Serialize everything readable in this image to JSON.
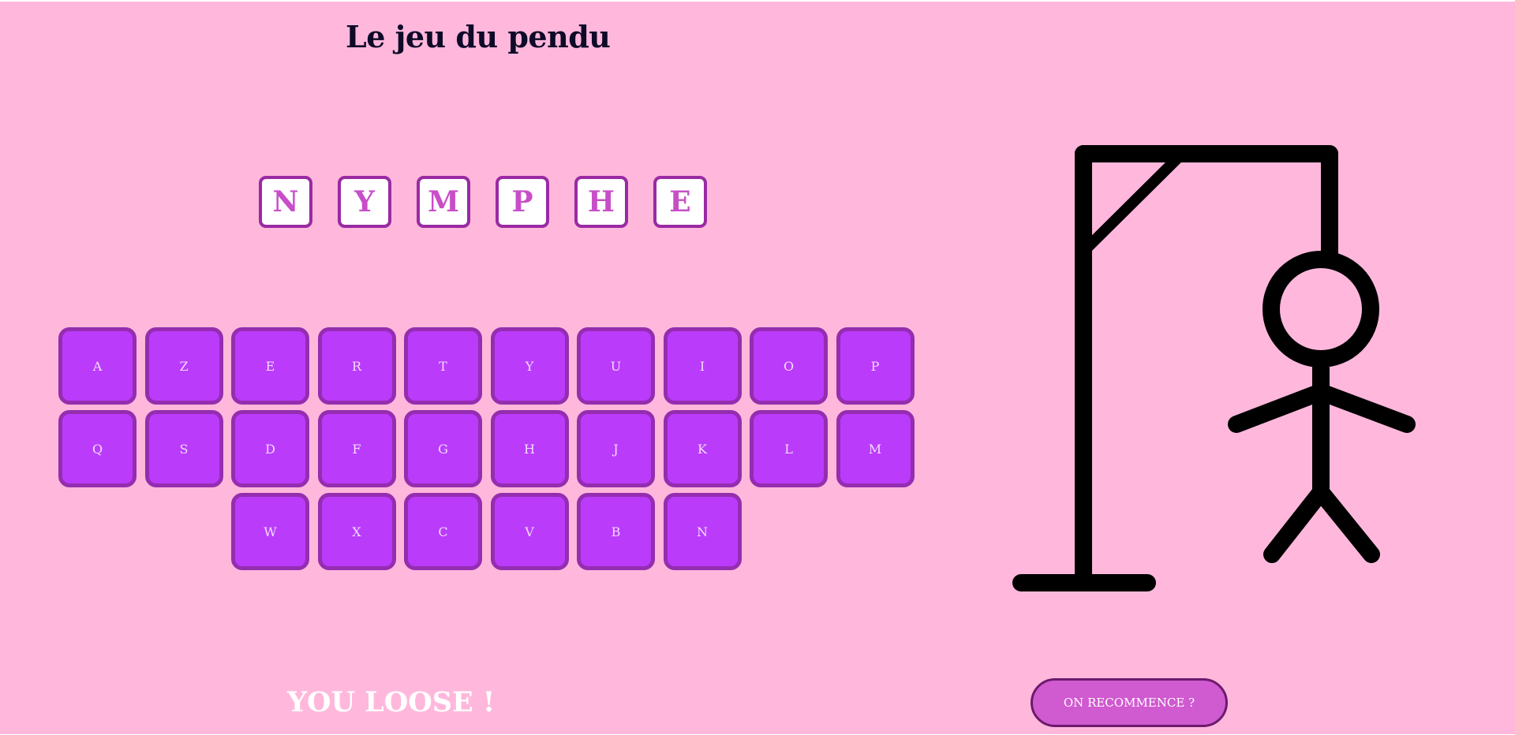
{
  "game": {
    "title": "Le jeu du pendu",
    "word_letters": [
      "N",
      "Y",
      "M",
      "P",
      "H",
      "E"
    ],
    "result_text": "YOU LOOSE !",
    "restart_label": "ON RECOMMENCE ?"
  },
  "keyboard": {
    "row1": [
      "A",
      "Z",
      "E",
      "R",
      "T",
      "Y",
      "U",
      "I",
      "O",
      "P"
    ],
    "row2": [
      "Q",
      "S",
      "D",
      "F",
      "G",
      "H",
      "J",
      "K",
      "L",
      "M"
    ],
    "row3": [
      "W",
      "X",
      "C",
      "V",
      "B",
      "N"
    ]
  },
  "colors": {
    "background": "#ffb8dc",
    "key_fill": "#bb3bfb",
    "key_border": "#952db0",
    "letter_color": "#c84ec8",
    "button_fill": "#d05ad0"
  },
  "hangman": {
    "parts_shown": [
      "base",
      "post",
      "beam",
      "brace",
      "rope",
      "head",
      "body",
      "left-arm",
      "right-arm",
      "left-leg",
      "right-leg"
    ]
  }
}
